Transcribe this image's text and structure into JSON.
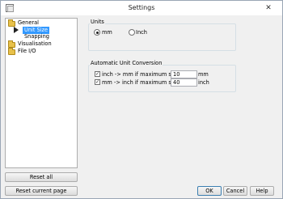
{
  "window": {
    "title": "Settings",
    "close_glyph": "✕"
  },
  "tree": {
    "items": [
      {
        "label": "General",
        "icon": "folder-open-icon"
      },
      {
        "label": "Unit Size",
        "icon": "arrow-right-icon",
        "selected": true
      },
      {
        "label": "Snapping"
      },
      {
        "label": "Visualisation",
        "icon": "folder-icon"
      },
      {
        "label": "File I/O",
        "icon": "folder-icon"
      }
    ]
  },
  "left_buttons": {
    "reset_all": "Reset all",
    "reset_current": "Reset current page"
  },
  "units": {
    "group_label": "Units",
    "options": [
      {
        "label": "mm",
        "checked": true
      },
      {
        "label": "Inch",
        "checked": false
      }
    ]
  },
  "conversion": {
    "group_label": "Automatic Unit Conversion",
    "rows": [
      {
        "label": "inch -> mm if maximum size <",
        "checked": true,
        "value": "10",
        "unit": "mm"
      },
      {
        "label": "mm -> inch if maximum size >",
        "checked": true,
        "value": "40",
        "unit": "inch"
      }
    ]
  },
  "footer": {
    "ok": "OK",
    "cancel": "Cancel",
    "help": "Help"
  }
}
